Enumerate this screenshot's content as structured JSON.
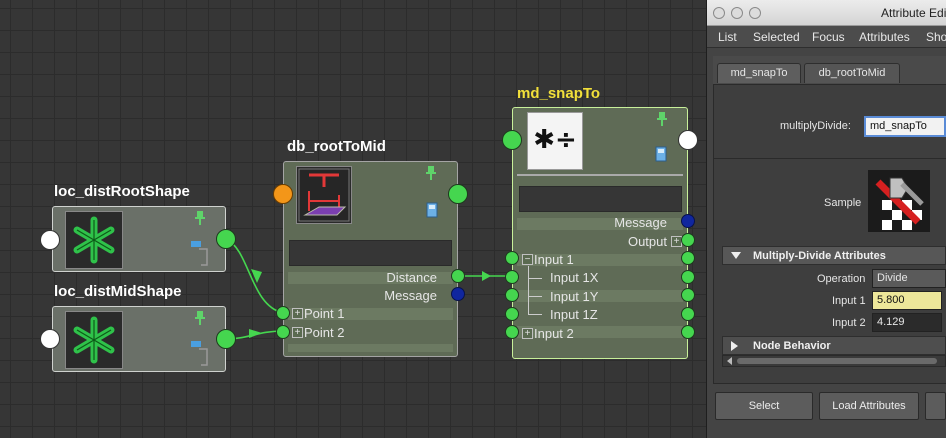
{
  "graph": {
    "nodes": {
      "loc_distRoot": {
        "title": "loc_distRootShape"
      },
      "loc_distMid": {
        "title": "loc_distMidShape"
      },
      "db_rootToMid": {
        "title": "db_rootToMid",
        "attrs": {
          "distance": "Distance",
          "message": "Message",
          "point1": "Point 1",
          "point2": "Point 2"
        }
      },
      "md_snapTo": {
        "title": "md_snapTo",
        "icon_text": "✱÷",
        "attrs": {
          "message": "Message",
          "output": "Output",
          "input1": "Input 1",
          "input1x": "Input 1X",
          "input1y": "Input 1Y",
          "input1z": "Input 1Z",
          "input2": "Input 2"
        }
      }
    }
  },
  "attribute_editor": {
    "window_title": "Attribute Edi",
    "menu": [
      "List",
      "Selected",
      "Focus",
      "Attributes",
      "Sho"
    ],
    "tabs": [
      "md_snapTo",
      "db_rootToMid"
    ],
    "node_type_label": "multiplyDivide:",
    "node_name": "md_snapTo",
    "sample_label": "Sample",
    "section_multiply": "Multiply-Divide Attributes",
    "operation_label": "Operation",
    "operation_value": "Divide",
    "input1_label": "Input 1",
    "input1_value": "5.800",
    "input2_label": "Input 2",
    "input2_value": "4.129",
    "section_behavior": "Node Behavior",
    "buttons": {
      "select": "Select",
      "load": "Load Attributes"
    }
  },
  "colors": {
    "port_green": "#45d64f",
    "port_blue": "#10269e",
    "port_orange": "#f39619",
    "selected_title": "#f2e03a",
    "wire": "#45d64f"
  }
}
